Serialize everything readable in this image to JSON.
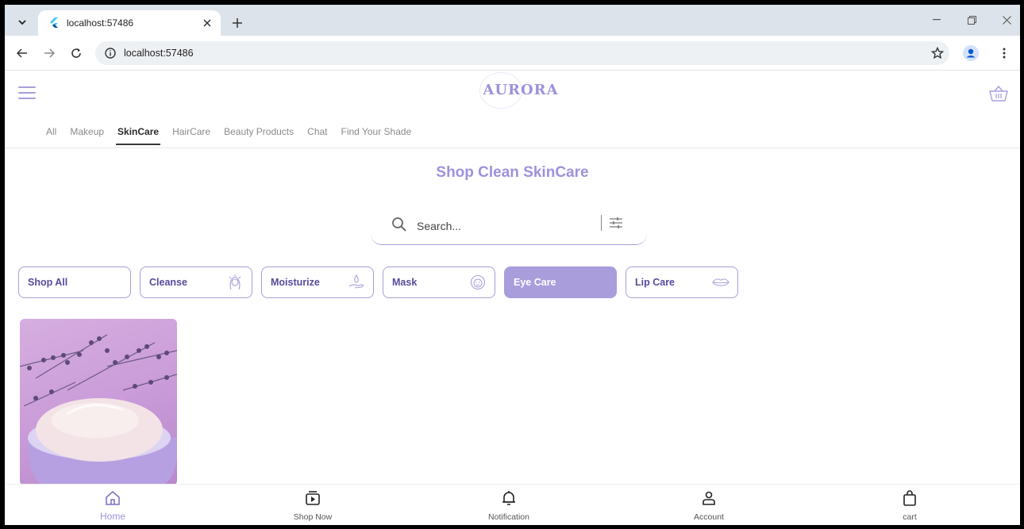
{
  "browser": {
    "tab_title": "localhost:57486",
    "url": "localhost:57486"
  },
  "app": {
    "logo": "AURORA",
    "category_tabs": [
      {
        "label": "All",
        "active": false
      },
      {
        "label": "Makeup",
        "active": false
      },
      {
        "label": "SkinCare",
        "active": true
      },
      {
        "label": "HairCare",
        "active": false
      },
      {
        "label": "Beauty Products",
        "active": false
      },
      {
        "label": "Chat",
        "active": false
      },
      {
        "label": "Find Your Shade",
        "active": false
      }
    ],
    "page_title": "Shop Clean SkinCare",
    "search": {
      "placeholder": "Search..."
    },
    "filter_chips": [
      {
        "label": "Shop All",
        "icon": "none",
        "active": false
      },
      {
        "label": "Cleanse",
        "icon": "face-wash-icon",
        "active": false
      },
      {
        "label": "Moisturize",
        "icon": "hand-drop-icon",
        "active": false
      },
      {
        "label": "Mask",
        "icon": "face-mask-icon",
        "active": false
      },
      {
        "label": "Eye Care",
        "icon": "none",
        "active": true
      },
      {
        "label": "Lip Care",
        "icon": "lips-icon",
        "active": false
      }
    ],
    "bottom_nav": [
      {
        "label": "Home",
        "icon": "home-icon",
        "active": true
      },
      {
        "label": "Shop Now",
        "icon": "shop-play-icon",
        "active": false
      },
      {
        "label": "Notification",
        "icon": "bell-icon",
        "active": false
      },
      {
        "label": "Account",
        "icon": "person-icon",
        "active": false
      },
      {
        "label": "cart",
        "icon": "shopping-bag-icon",
        "active": false
      }
    ]
  },
  "colors": {
    "accent": "#9d92dc",
    "accent_dark": "#564a9c",
    "chip_active_bg": "#a99ddb"
  }
}
